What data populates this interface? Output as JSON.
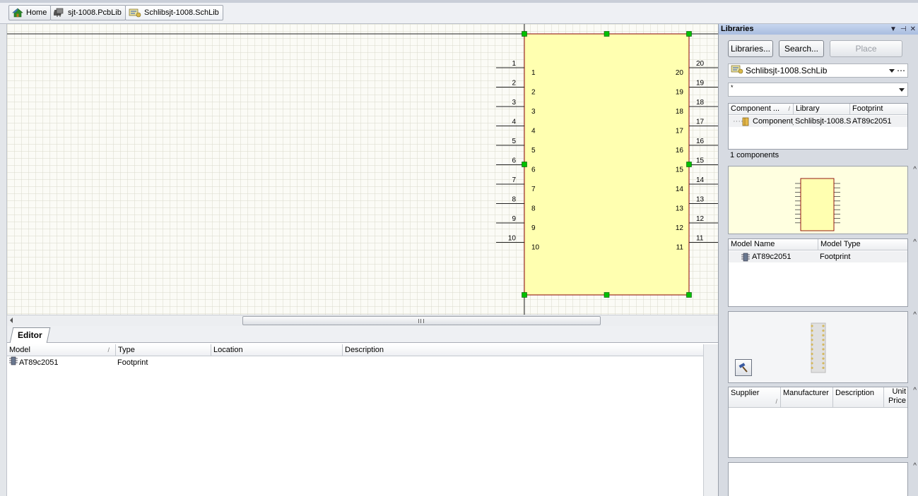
{
  "tabs": [
    {
      "label": "Home",
      "icon": "home-icon"
    },
    {
      "label": "sjt-1008.PcbLib",
      "icon": "pcb-library-icon"
    },
    {
      "label": "Schlibsjt-1008.SchLib",
      "icon": "schematic-library-icon"
    }
  ],
  "schematic": {
    "left_pins": [
      "1",
      "2",
      "3",
      "4",
      "5",
      "6",
      "7",
      "8",
      "9",
      "10"
    ],
    "right_pins": [
      "20",
      "19",
      "18",
      "17",
      "16",
      "15",
      "14",
      "13",
      "12",
      "11"
    ],
    "body_color": "#ffffb0",
    "border_color": "#8a0000",
    "handle_color": "#00c000"
  },
  "editor": {
    "tab_label": "Editor",
    "columns": [
      "Model",
      "Type",
      "Location",
      "Description"
    ],
    "rows": [
      {
        "model": "AT89c2051",
        "type": "Footprint",
        "location": "",
        "description": ""
      }
    ]
  },
  "libraries": {
    "title": "Libraries",
    "buttons": {
      "libraries": "Libraries...",
      "search": "Search...",
      "place": "Place"
    },
    "selected_library": "Schlibsjt-1008.SchLib",
    "filter_value": "*",
    "component_columns": [
      "Component ...",
      "Library",
      "Footprint"
    ],
    "components": [
      {
        "name": "Component_",
        "library": "Schlibsjt-1008.S",
        "footprint": "AT89c2051"
      }
    ],
    "count_text": "1 components",
    "model_columns": [
      "Model Name",
      "Model Type"
    ],
    "models": [
      {
        "name": "AT89c2051",
        "type": "Footprint"
      }
    ],
    "supplier_columns": [
      "Supplier",
      "Manufacturer",
      "Description",
      "Unit Price"
    ]
  }
}
